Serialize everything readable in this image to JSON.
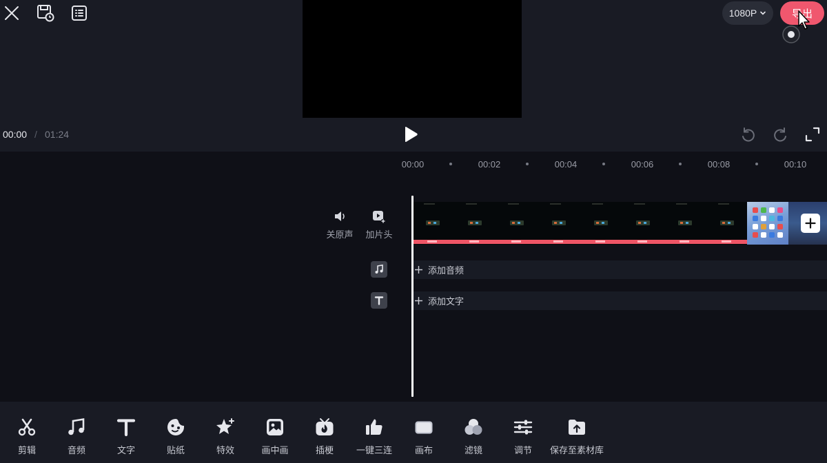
{
  "header": {
    "resolution": "1080P",
    "export_label": "导出",
    "icons": [
      "close-icon",
      "save-draft-icon",
      "list-icon",
      "chevron-down-icon",
      "cursor-icon",
      "record-dot-icon"
    ]
  },
  "playback": {
    "current_time": "00:00",
    "separator": "/",
    "total_time": "01:24",
    "icons": [
      "play-icon",
      "undo-icon",
      "redo-icon",
      "fullscreen-icon"
    ]
  },
  "timeline": {
    "ruler": [
      "00:00",
      "00:02",
      "00:04",
      "00:06",
      "00:08",
      "00:10"
    ],
    "track_tools": [
      {
        "label": "关原声",
        "icon": "speaker-icon"
      },
      {
        "label": "加片头",
        "icon": "add-intro-icon"
      }
    ],
    "add_audio_label": "添加音频",
    "add_text_label": "添加文字"
  },
  "toolbar": {
    "items": [
      {
        "label": "剪辑",
        "icon": "scissors-icon"
      },
      {
        "label": "音频",
        "icon": "music-icon"
      },
      {
        "label": "文字",
        "icon": "text-icon"
      },
      {
        "label": "贴纸",
        "icon": "sticker-icon"
      },
      {
        "label": "特效",
        "icon": "effects-star-icon"
      },
      {
        "label": "画中画",
        "icon": "picture-in-picture-icon"
      },
      {
        "label": "插梗",
        "icon": "tv-meme-icon"
      },
      {
        "label": "一键三连",
        "icon": "thumbs-up-icon"
      },
      {
        "label": "画布",
        "icon": "canvas-icon"
      },
      {
        "label": "滤镜",
        "icon": "filter-icon"
      },
      {
        "label": "调节",
        "icon": "adjust-sliders-icon"
      },
      {
        "label": "保存至素材库",
        "icon": "save-to-library-icon"
      }
    ]
  },
  "colors": {
    "accent": "#f0576e",
    "background": "#0f1017",
    "panel": "#191b24"
  }
}
